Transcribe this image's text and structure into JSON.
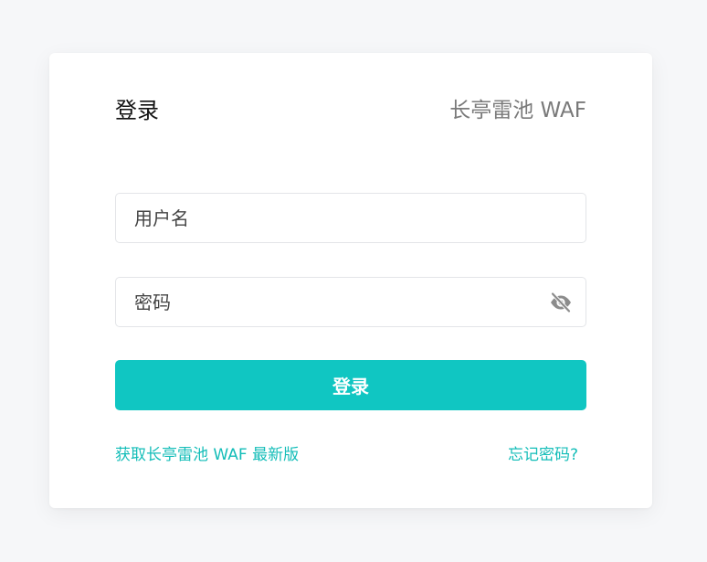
{
  "header": {
    "title": "登录",
    "brand": "长亭雷池 WAF"
  },
  "form": {
    "username_placeholder": "用户名",
    "password_placeholder": "密码",
    "password_toggle_icon": "eye-off-icon",
    "submit_label": "登录"
  },
  "links": {
    "download": "获取长亭雷池 WAF 最新版",
    "forgot_password": "忘记密码?"
  },
  "colors": {
    "accent": "#10c6c2",
    "link": "#13bdb8",
    "background": "#f6f7f9",
    "card": "#ffffff"
  }
}
